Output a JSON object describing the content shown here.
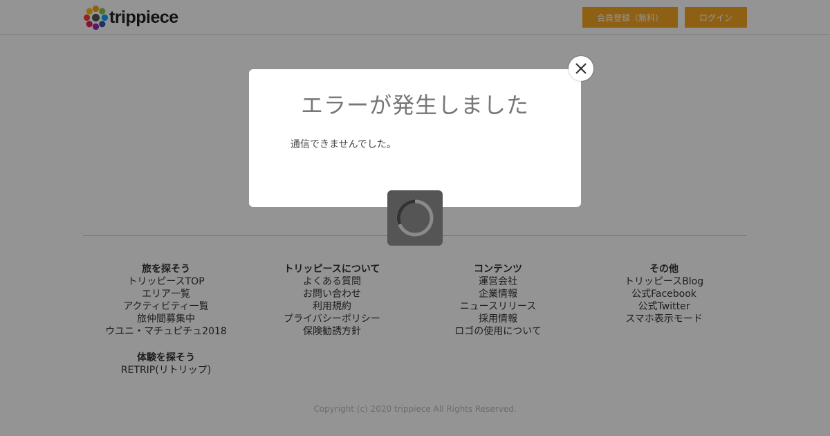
{
  "header": {
    "logo_text": "trippiece",
    "register_label": "会員登録（無料）",
    "login_label": "ログイン"
  },
  "colors": {
    "accent": "#f5a623",
    "overlay": "rgba(0,0,0,0.42)"
  },
  "footer": {
    "columns": [
      {
        "heading": "旅を探そう",
        "links": [
          "トリッピースTOP",
          "エリア一覧",
          "アクティビティ一覧",
          "旅仲間募集中",
          "ウユニ・マチュピチュ2018"
        ]
      },
      {
        "heading": "トリッピースについて",
        "links": [
          "よくある質問",
          "お問い合わせ",
          "利用規約",
          "プライバシーポリシー",
          "保険勧誘方針"
        ]
      },
      {
        "heading": "コンテンツ",
        "links": [
          "運営会社",
          "企業情報",
          "ニュースリリース",
          "採用情報",
          "ロゴの使用について"
        ]
      },
      {
        "heading": "その他",
        "links": [
          "トリッピースBlog",
          "公式Facebook",
          "公式Twitter",
          "スマホ表示モード"
        ]
      }
    ],
    "extra": {
      "heading": "体験を探そう",
      "links": [
        "RETRIP(リトリップ)"
      ]
    },
    "copyright": "Copyright (c) 2020 trippiece All Rights Reserved."
  },
  "modal": {
    "title": "エラーが発生しました",
    "message": "通信できませんでした。",
    "close_icon": "close-icon"
  },
  "spinner": {
    "icon": "loading-spinner-icon"
  }
}
